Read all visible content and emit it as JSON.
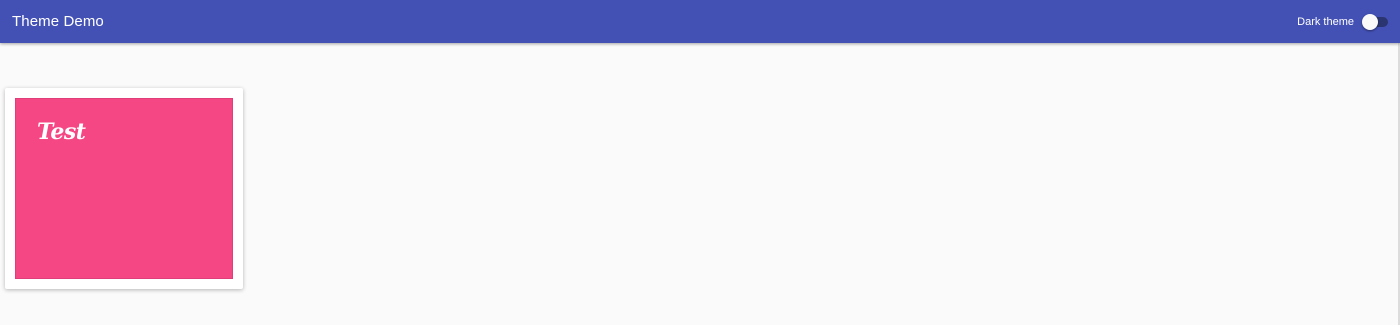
{
  "header": {
    "title": "Theme Demo",
    "toggle_label": "Dark theme",
    "toggle_on": false
  },
  "card": {
    "heading": "Test"
  },
  "colors": {
    "toolbar": "#4351b5",
    "background": "#fafafa",
    "card_panel": "#f64785",
    "toggle_track": "#2b356f"
  }
}
